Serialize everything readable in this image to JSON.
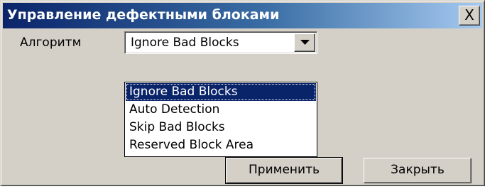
{
  "window": {
    "title": "Управление дефектными блоками",
    "close_label": "X"
  },
  "form": {
    "algorithm_label": "Алгоритм",
    "algorithm_value": "Ignore Bad Blocks"
  },
  "dropdown": {
    "options": [
      "Ignore Bad Blocks",
      "Auto Detection",
      "Skip Bad Blocks",
      "Reserved Block Area"
    ],
    "selected_index": 0
  },
  "buttons": {
    "apply": "Применить",
    "close": "Закрыть"
  },
  "colors": {
    "titlebar_start": "#0a246a",
    "titlebar_end": "#a6caf0",
    "face": "#d4d0c8",
    "selection": "#0a246a"
  },
  "icons": {
    "combo_arrow": "triangle-down-icon",
    "close": "close-icon"
  }
}
